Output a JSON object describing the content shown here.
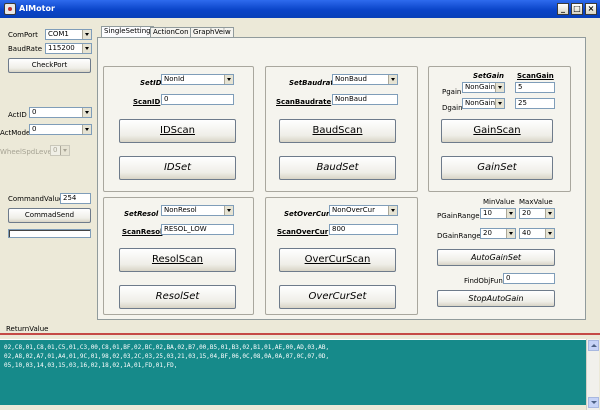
{
  "window": {
    "title": "AIMotor",
    "minimize": "_",
    "maximize": "□",
    "close": "×"
  },
  "left_panel": {
    "comport_label": "ComPort",
    "comport_value": "COM1",
    "baudrate_label": "BaudRate",
    "baudrate_value": "115200",
    "checkport_button": "CheckPort",
    "actid_label": "ActID",
    "actid_value": "0",
    "actmode_label": "ActMode",
    "actmode_value": "0",
    "wheelspd_label": "WheelSpdLevel",
    "wheelspd_value": "0",
    "commandvalue_label": "CommandValue",
    "commandvalue_value": "254",
    "commandsend_button": "CommadSend"
  },
  "tabs": [
    "SingleSetting",
    "ActionCon",
    "GraphVeiw"
  ],
  "id_group": {
    "setid_label": "SetID",
    "setid_value": "NonId",
    "scanid_label": "ScanID",
    "scanid_value": "0",
    "idscan_button": "IDScan",
    "idset_button": "IDSet"
  },
  "baud_group": {
    "setbaud_label": "SetBaudrate",
    "setbaud_value": "NonBaud",
    "scanbaud_label": "ScanBaudrate",
    "scanbaud_value": "NonBaud",
    "baudscan_button": "BaudScan",
    "baudset_button": "BaudSet"
  },
  "gain_group": {
    "setgain_label": "SetGain",
    "scangain_label": "ScanGain",
    "pgain_label": "Pgain",
    "pgain_value": "NonGain",
    "pgain_scan": "5",
    "dgain_label": "Dgain",
    "dgain_value": "NonGain",
    "dgain_scan": "25",
    "gainscan_button": "GainScan",
    "gainset_button": "GainSet"
  },
  "resol_group": {
    "setresol_label": "SetResol",
    "setresol_value": "NonResol",
    "scanresol_label": "ScanResol",
    "scanresol_value": "RESOL_LOW",
    "resolscan_button": "ResolScan",
    "resolset_button": "ResolSet"
  },
  "overcur_group": {
    "setovercur_label": "SetOverCur",
    "setovercur_value": "NonOverCur",
    "scanovercur_label": "ScanOverCur",
    "scanovercur_value": "800",
    "overcurscan_button": "OverCurScan",
    "overcurset_button": "OverCurSet"
  },
  "autogain": {
    "minvalue_label": "MinValue",
    "maxvalue_label": "MaxValue",
    "pgainrange_label": "PGainRange",
    "pgain_min": "10",
    "pgain_max": "20",
    "dgainrange_label": "DGainRange",
    "dgain_min": "20",
    "dgain_max": "40",
    "autogainset_button": "AutoGainSet",
    "findobjfun_label": "FindObjFun",
    "findobjfun_value": "0",
    "stopautogain_button": "StopAutoGain"
  },
  "return_value_label": "ReturnValue",
  "console_lines": [
    "02,C8,01,C8,01,C5,01,C3,00,C8,01,BF,02,BC,02,BA,02,B7,00,B5,01,B3,02,B1,01,AE,00,AD,03,AB,",
    "02,A8,02,A7,01,A4,01,9C,01,98,02,03,2C,03,25,03,21,03,15,04,BF,06,0C,08,0A,0A,07,0C,07,0D,",
    "05,10,03,14,03,15,03,16,02,18,02,1A,01,FD,01,FD,"
  ]
}
